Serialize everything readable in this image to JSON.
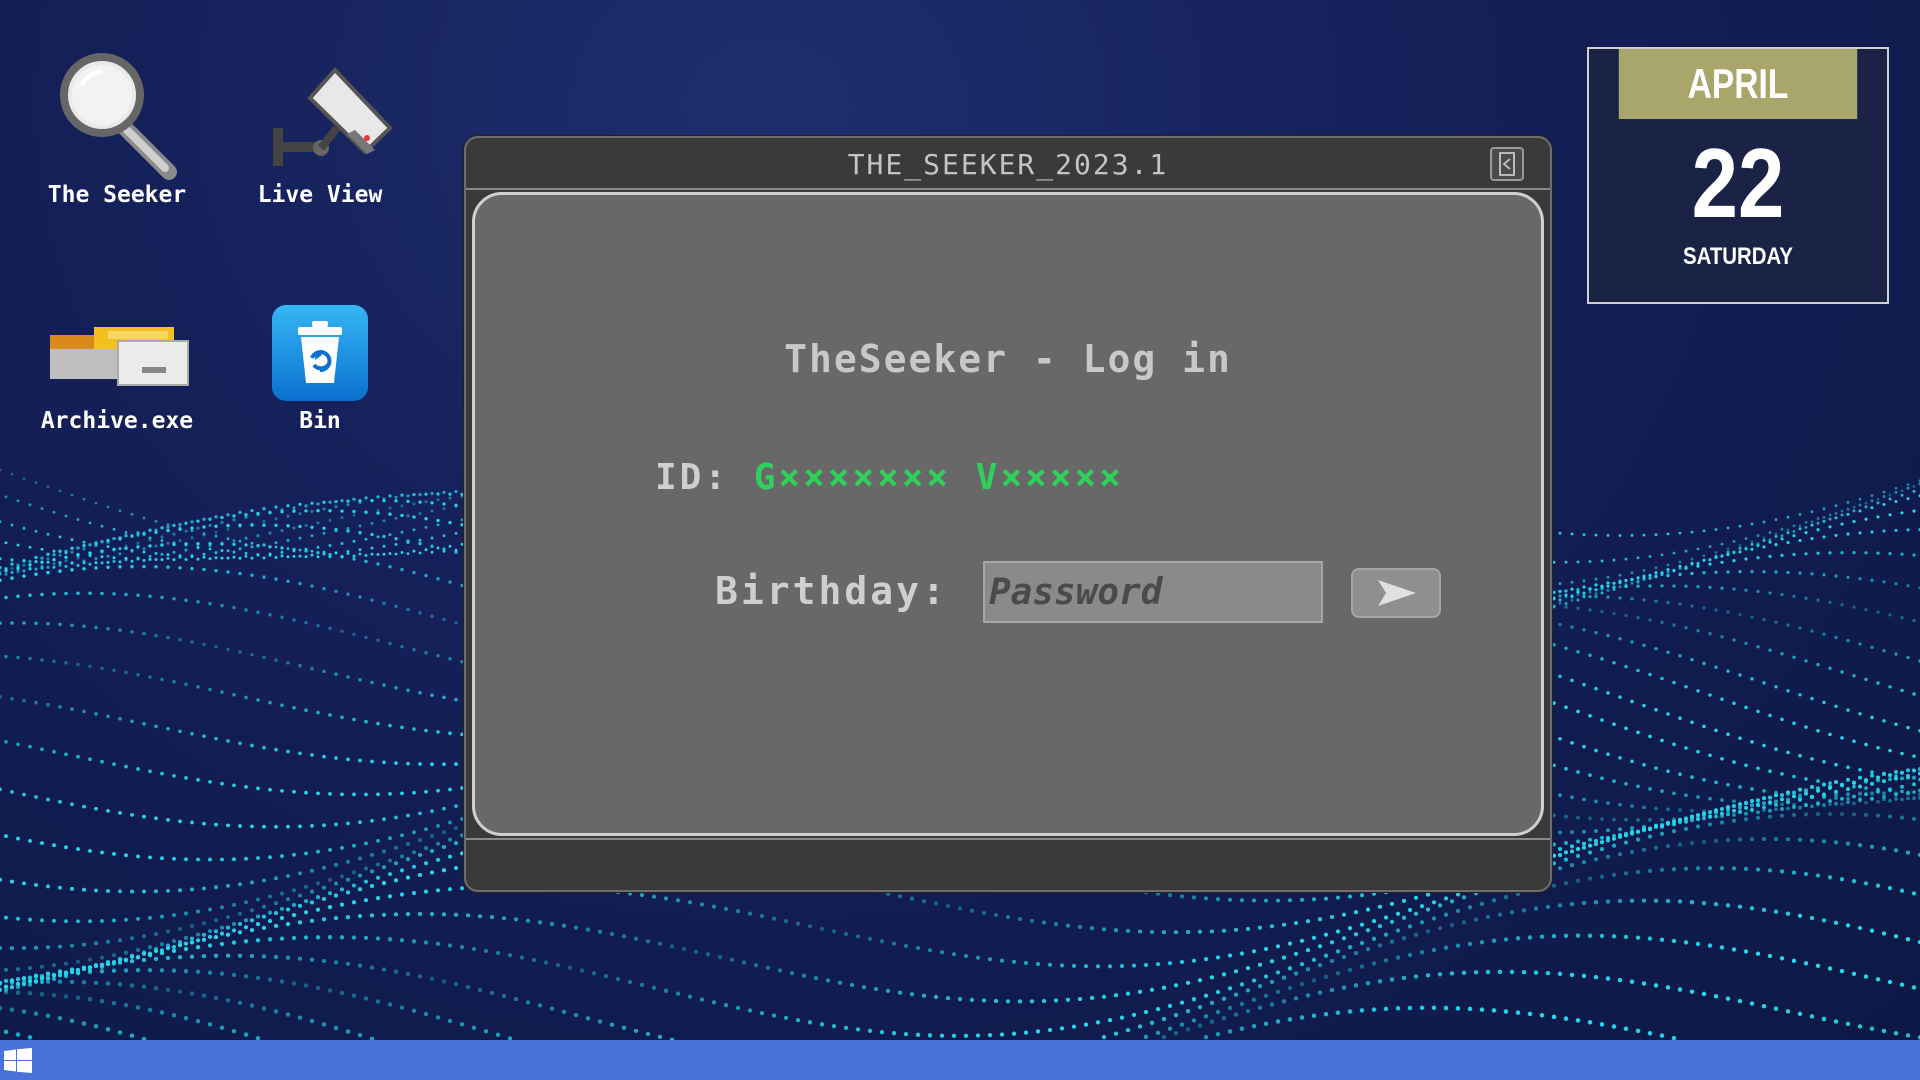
{
  "desktop": {
    "icons": [
      {
        "label": "The Seeker",
        "icon": "magnifier-icon"
      },
      {
        "label": "Live View",
        "icon": "security-camera-icon"
      },
      {
        "label": "Archive.exe",
        "icon": "archive-drawer-icon"
      },
      {
        "label": "Bin",
        "icon": "recycle-bin-icon"
      }
    ]
  },
  "window": {
    "title": "THE_SEEKER_2023.1",
    "logout_icon": "logout-icon",
    "login": {
      "heading": "TheSeeker - Log in",
      "id_label": "ID:",
      "id_value": "G××××××× V×××××",
      "birthday_label": "Birthday:",
      "password_placeholder": "Password",
      "submit_icon": "arrow-right-icon"
    }
  },
  "calendar": {
    "month": "APRIL",
    "day": "22",
    "weekday": "SATURDAY",
    "month_color": "#a8a66a"
  },
  "taskbar": {
    "start_icon": "windows-logo-icon",
    "color": "#4a72d8"
  }
}
